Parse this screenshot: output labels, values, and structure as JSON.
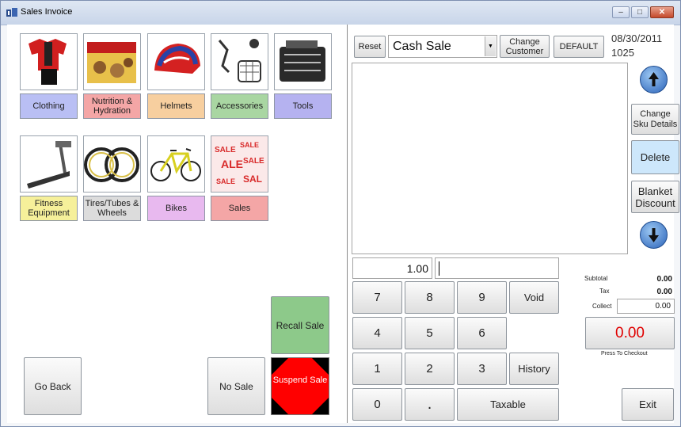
{
  "window": {
    "title": "Sales Invoice"
  },
  "categories": [
    {
      "label": "Clothing",
      "color": "#b9bff4"
    },
    {
      "label": "Nutrition & Hydration",
      "color": "#f4a6a6"
    },
    {
      "label": "Helmets",
      "color": "#f7cf9f"
    },
    {
      "label": "Accessories",
      "color": "#a9d6a2"
    },
    {
      "label": "Tools",
      "color": "#b5b2f0"
    },
    {
      "label": "Fitness Equipment",
      "color": "#f6f09a"
    },
    {
      "label": "Tires/Tubes & Wheels",
      "color": "#dcdcdc"
    },
    {
      "label": "Bikes",
      "color": "#e8b9ef"
    },
    {
      "label": "Sales",
      "color": "#f4a6a6"
    }
  ],
  "left_actions": {
    "go_back": "Go Back",
    "no_sale": "No Sale",
    "recall_sale": "Recall Sale",
    "suspend_sale": "Suspend Sale"
  },
  "header": {
    "reset": "Reset",
    "customer": "Cash Sale",
    "change_customer": "Change Customer",
    "default": "DEFAULT",
    "date": "08/30/2011",
    "number": "1025"
  },
  "side_buttons": {
    "change_sku": "Change Sku Details",
    "delete": "Delete",
    "blanket_discount": "Blanket Discount"
  },
  "entry": {
    "quantity": "1.00",
    "code": ""
  },
  "keypad": {
    "k7": "7",
    "k8": "8",
    "k9": "9",
    "void": "Void",
    "k4": "4",
    "k5": "5",
    "k6": "6",
    "k1": "1",
    "k2": "2",
    "k3": "3",
    "history": "History",
    "k0": "0",
    "dot": ".",
    "taxable": "Taxable"
  },
  "totals": {
    "subtotal_label": "Subtotal",
    "subtotal": "0.00",
    "tax_label": "Tax",
    "tax": "0.00",
    "collect_label": "Collect",
    "collect": "0.00",
    "checkout_amount": "0.00",
    "checkout_hint": "Press To Checkout"
  },
  "exit": "Exit",
  "colors": {
    "recall": "#8dc98a",
    "suspend": "#ff0000",
    "checkout_text": "#e00000",
    "delete_bg": "#cde7fb"
  }
}
